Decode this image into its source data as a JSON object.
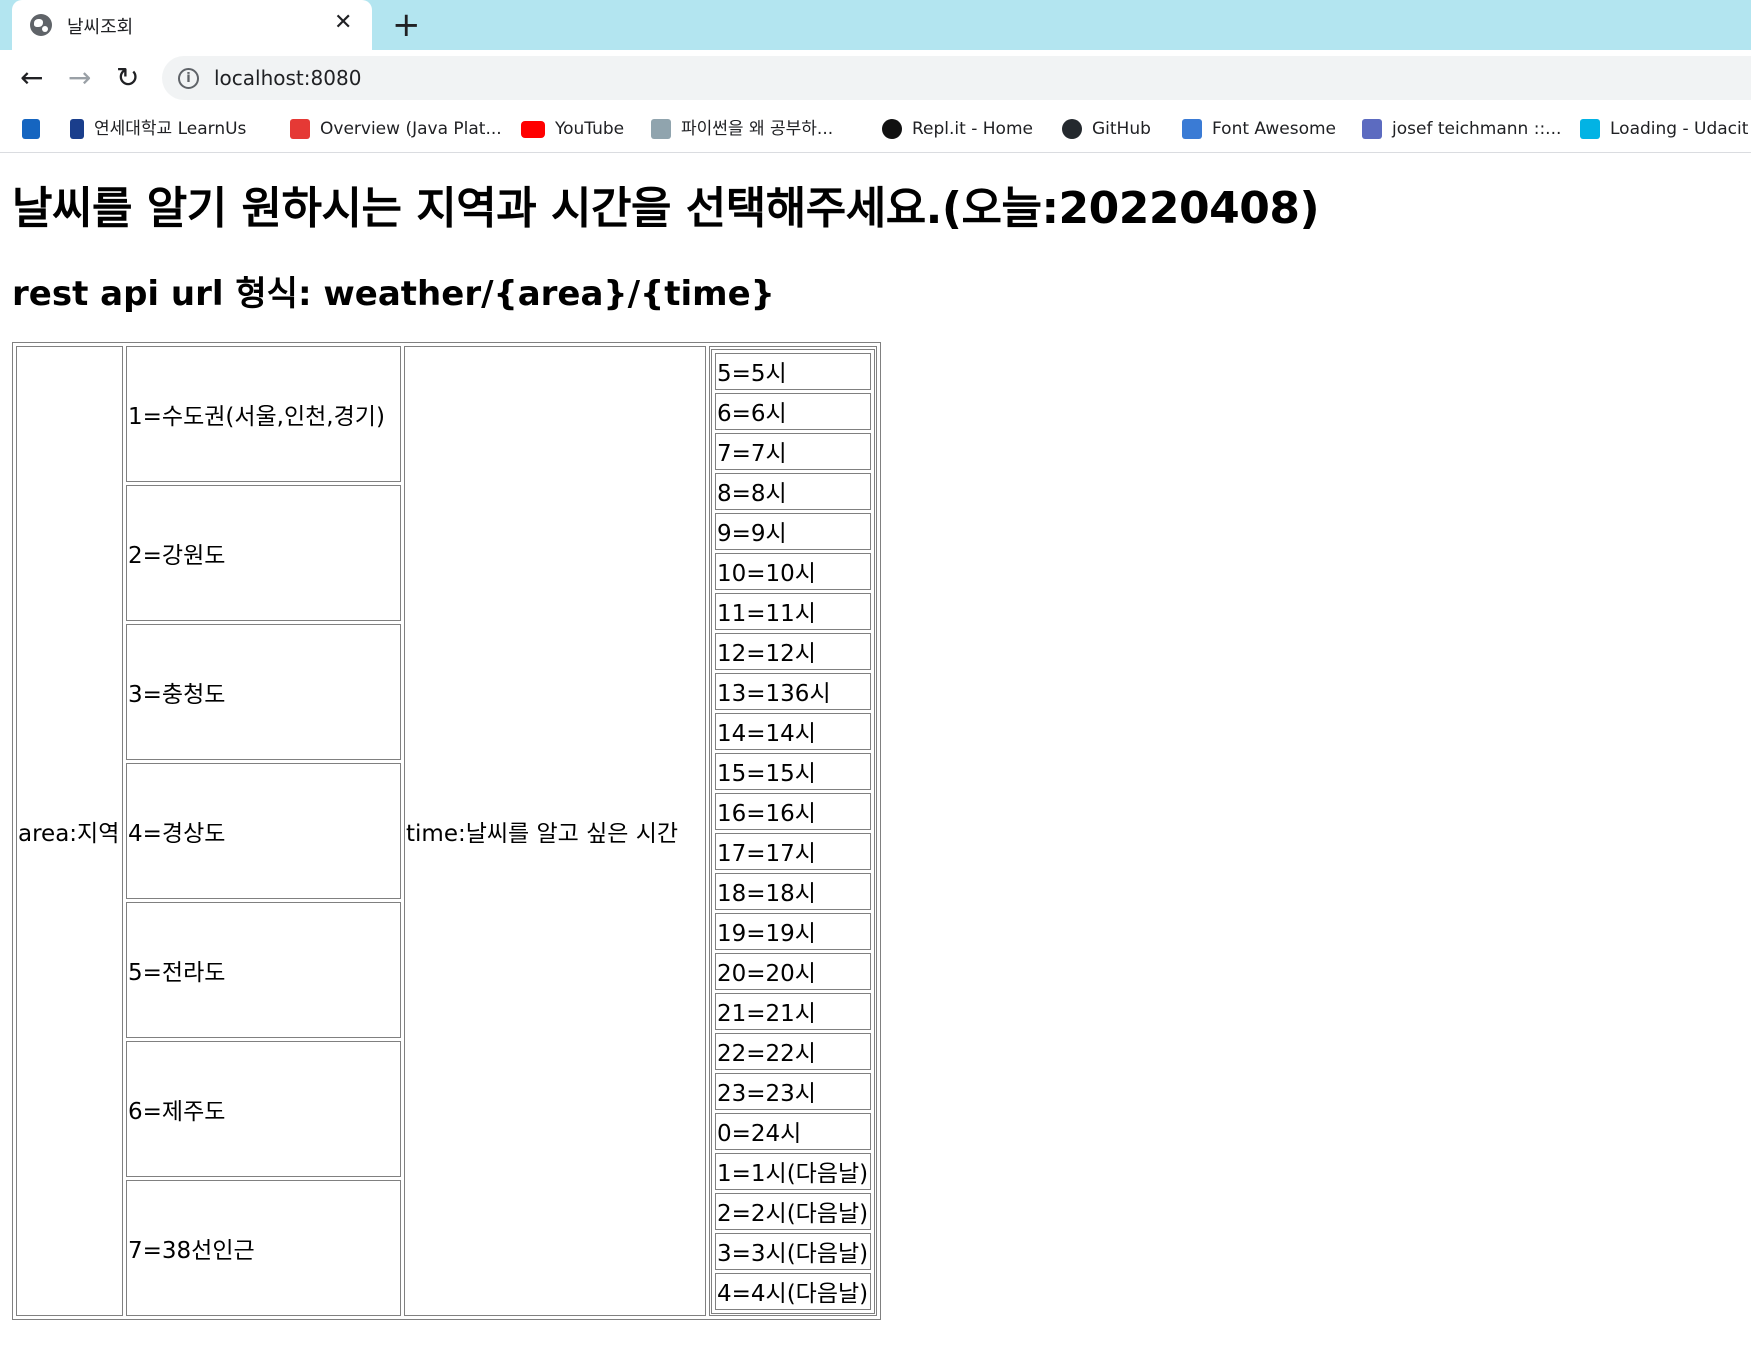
{
  "browser": {
    "tab_title": "날씨조회",
    "url": "localhost:8080",
    "bookmarks": [
      {
        "label": "",
        "color": "#1565c0"
      },
      {
        "label": "연세대학교 LearnUs",
        "color": "#1a3e8c"
      },
      {
        "label": "Overview (Java Plat...",
        "color": "#e53935"
      },
      {
        "label": "YouTube",
        "color": "#ff0000"
      },
      {
        "label": "파이썬을 왜 공부하...",
        "color": "#90a4ae"
      },
      {
        "label": "Repl.it - Home",
        "color": "#111111"
      },
      {
        "label": "GitHub",
        "color": "#24292e"
      },
      {
        "label": "Font Awesome",
        "color": "#3a7bd5"
      },
      {
        "label": "josef teichmann ::...",
        "color": "#5c6bc0"
      },
      {
        "label": "Loading - Udacit",
        "color": "#02b3e4"
      }
    ]
  },
  "page": {
    "heading": "날씨를 알기 원하시는 지역과 시간을 선택해주세요.(오늘:20220408)",
    "subheading": "rest api url 형식: weather/{area}/{time}",
    "area_label": "area:지역",
    "time_label": "time:날씨를 알고 싶은 시간",
    "regions": [
      "1=수도권(서울,인천,경기)",
      "2=강원도",
      "3=충청도",
      "4=경상도",
      "5=전라도",
      "6=제주도",
      "7=38선인근"
    ],
    "hours": [
      "5=5시",
      "6=6시",
      "7=7시",
      "8=8시",
      "9=9시",
      "10=10시",
      "11=11시",
      "12=12시",
      "13=136시",
      "14=14시",
      "15=15시",
      "16=16시",
      "17=17시",
      "18=18시",
      "19=19시",
      "20=20시",
      "21=21시",
      "22=22시",
      "23=23시",
      "0=24시",
      "1=1시(다음날)",
      "2=2시(다음날)",
      "3=3시(다음날)",
      "4=4시(다음날)"
    ]
  }
}
